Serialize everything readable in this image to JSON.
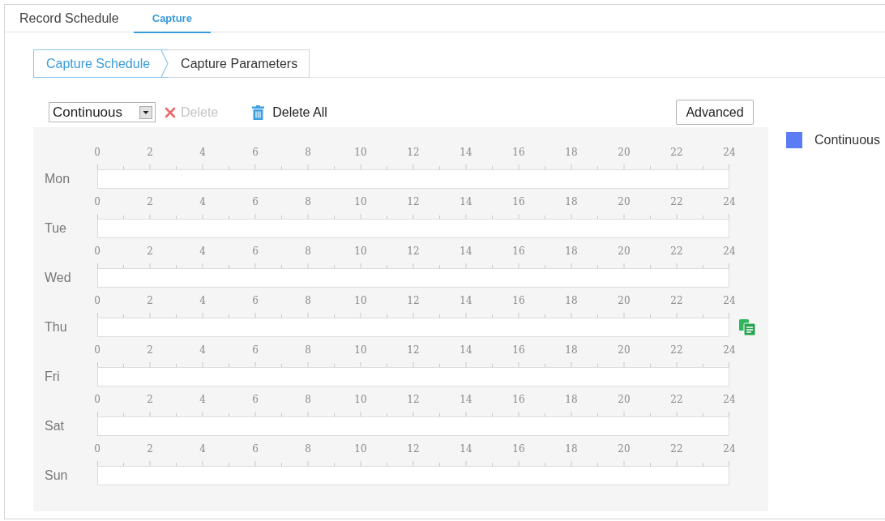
{
  "tabs": [
    {
      "label": "Record Schedule",
      "selected": false
    },
    {
      "label": "Capture",
      "selected": true
    }
  ],
  "sub_tabs": [
    {
      "label": "Capture Schedule",
      "selected": true
    },
    {
      "label": "Capture Parameters",
      "selected": false
    }
  ],
  "toolbar": {
    "type_select": {
      "value": "Continuous"
    },
    "delete": {
      "label": "Delete",
      "disabled": true
    },
    "delete_all": {
      "label": "Delete All",
      "disabled": false
    },
    "advanced": {
      "label": "Advanced"
    }
  },
  "schedule": {
    "days": [
      {
        "label": "Mon",
        "hour_labels": [
          "0",
          "2",
          "4",
          "6",
          "8",
          "10",
          "12",
          "14",
          "16",
          "18",
          "20",
          "22",
          "24"
        ],
        "copy_visible": false
      },
      {
        "label": "Tue",
        "hour_labels": [
          "0",
          "2",
          "4",
          "6",
          "8",
          "10",
          "12",
          "14",
          "16",
          "18",
          "20",
          "22",
          "24"
        ],
        "copy_visible": false
      },
      {
        "label": "Wed",
        "hour_labels": [
          "0",
          "2",
          "4",
          "6",
          "8",
          "10",
          "12",
          "14",
          "16",
          "18",
          "20",
          "22",
          "24"
        ],
        "copy_visible": false
      },
      {
        "label": "Thu",
        "hour_labels": [
          "0",
          "2",
          "4",
          "6",
          "8",
          "10",
          "12",
          "14",
          "16",
          "18",
          "20",
          "22",
          "24"
        ],
        "copy_visible": true
      },
      {
        "label": "Fri",
        "hour_labels": [
          "0",
          "2",
          "4",
          "6",
          "8",
          "10",
          "12",
          "14",
          "16",
          "18",
          "20",
          "22",
          "24"
        ],
        "copy_visible": false
      },
      {
        "label": "Sat",
        "hour_labels": [
          "0",
          "2",
          "4",
          "6",
          "8",
          "10",
          "12",
          "14",
          "16",
          "18",
          "20",
          "22",
          "24"
        ],
        "copy_visible": false
      },
      {
        "label": "Sun",
        "hour_labels": [
          "0",
          "2",
          "4",
          "6",
          "8",
          "10",
          "12",
          "14",
          "16",
          "18",
          "20",
          "22",
          "24"
        ],
        "copy_visible": false
      }
    ]
  },
  "legend": [
    {
      "label": "Continuous",
      "color": "#5b7cf2"
    }
  ]
}
